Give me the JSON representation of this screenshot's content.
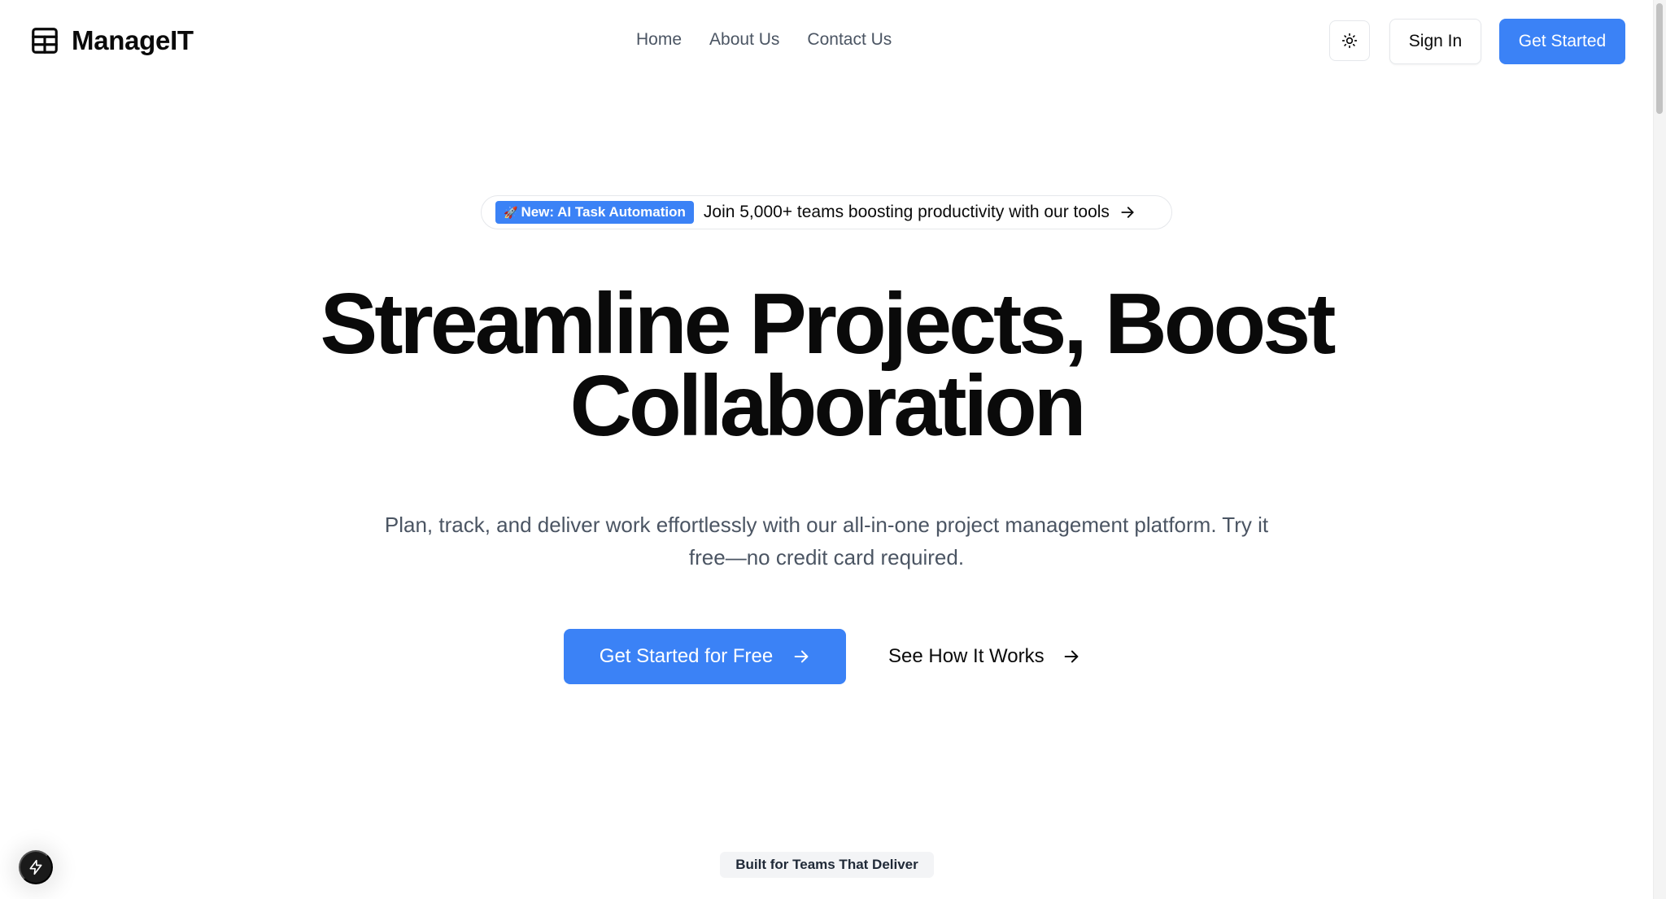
{
  "header": {
    "brand": {
      "name": "ManageIT",
      "icon": "layout-grid-icon"
    },
    "nav": [
      {
        "label": "Home"
      },
      {
        "label": "About Us"
      },
      {
        "label": "Contact Us"
      }
    ],
    "theme_toggle_icon": "sun-icon",
    "sign_in_label": "Sign In",
    "get_started_label": "Get Started"
  },
  "announcement": {
    "badge_icon": "🚀",
    "badge_label": "New: AI Task Automation",
    "text": "Join 5,000+ teams boosting productivity with our tools",
    "arrow_icon": "arrow-right-icon"
  },
  "hero": {
    "title_line1": "Streamline Projects, Boost",
    "title_line2": "Collaboration",
    "subtitle": "Plan, track, and deliver work effortlessly with our all-in-one project management platform. Try it free—no credit card required.",
    "cta_primary": "Get Started for Free",
    "cta_secondary": "See How It Works"
  },
  "section": {
    "label": "Built for Teams That Deliver"
  },
  "floating_button_icon": "bolt-icon",
  "colors": {
    "accent": "#3b82f6",
    "text": "#0a0a0a",
    "muted_text": "#4b5563",
    "border": "#e5e7eb"
  }
}
